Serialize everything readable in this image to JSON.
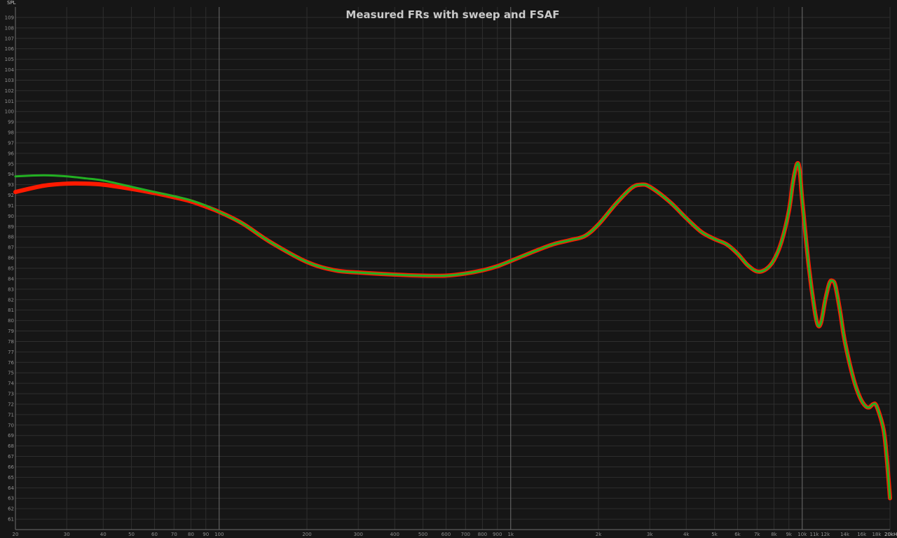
{
  "chart_data": {
    "type": "line",
    "title": "Measured FRs with sweep and FSAF",
    "ylabel": "SPL",
    "x_unit_label": "20kHz",
    "x_scale": "log",
    "xlim": [
      20,
      20000
    ],
    "ylim": [
      60,
      110
    ],
    "grid": true,
    "legend": "none",
    "background_color": "#161616",
    "grid_color": "#2e2e2e",
    "grid_major_color": "#6e6e6e",
    "series": [
      {
        "color": "#ff1a00",
        "points": [
          [
            20,
            92.3
          ],
          [
            25,
            92.9
          ],
          [
            30,
            93.1
          ],
          [
            35,
            93.1
          ],
          [
            40,
            93.0
          ],
          [
            50,
            92.6
          ],
          [
            60,
            92.2
          ],
          [
            70,
            91.8
          ],
          [
            80,
            91.4
          ],
          [
            90,
            90.9
          ],
          [
            100,
            90.4
          ],
          [
            120,
            89.3
          ],
          [
            150,
            87.5
          ],
          [
            200,
            85.6
          ],
          [
            250,
            84.8
          ],
          [
            300,
            84.6
          ],
          [
            400,
            84.4
          ],
          [
            500,
            84.3
          ],
          [
            600,
            84.3
          ],
          [
            700,
            84.5
          ],
          [
            800,
            84.8
          ],
          [
            900,
            85.2
          ],
          [
            1000,
            85.7
          ],
          [
            1200,
            86.6
          ],
          [
            1400,
            87.3
          ],
          [
            1600,
            87.7
          ],
          [
            1800,
            88.1
          ],
          [
            2000,
            89.2
          ],
          [
            2300,
            91.2
          ],
          [
            2600,
            92.7
          ],
          [
            2800,
            93.0
          ],
          [
            3000,
            92.8
          ],
          [
            3500,
            91.4
          ],
          [
            4000,
            89.8
          ],
          [
            4500,
            88.5
          ],
          [
            5000,
            87.8
          ],
          [
            5500,
            87.3
          ],
          [
            6000,
            86.4
          ],
          [
            6500,
            85.3
          ],
          [
            7000,
            84.7
          ],
          [
            7500,
            84.9
          ],
          [
            8000,
            85.8
          ],
          [
            8500,
            87.6
          ],
          [
            9000,
            90.5
          ],
          [
            9300,
            93.3
          ],
          [
            9600,
            95.0
          ],
          [
            9800,
            94.4
          ],
          [
            10000,
            91.5
          ],
          [
            10500,
            85.5
          ],
          [
            11000,
            81.2
          ],
          [
            11300,
            79.6
          ],
          [
            11600,
            79.8
          ],
          [
            12000,
            82.0
          ],
          [
            12400,
            83.6
          ],
          [
            12700,
            83.8
          ],
          [
            13000,
            83.3
          ],
          [
            13500,
            80.8
          ],
          [
            14000,
            78.0
          ],
          [
            15000,
            74.4
          ],
          [
            15800,
            72.6
          ],
          [
            16500,
            71.8
          ],
          [
            17000,
            71.7
          ],
          [
            17500,
            72.0
          ],
          [
            18000,
            71.8
          ],
          [
            19000,
            69.6
          ],
          [
            19500,
            66.8
          ],
          [
            20000,
            63.0
          ]
        ]
      },
      {
        "color": "#22b022",
        "points": [
          [
            20,
            93.8
          ],
          [
            25,
            93.9
          ],
          [
            30,
            93.8
          ],
          [
            35,
            93.6
          ],
          [
            40,
            93.4
          ],
          [
            50,
            92.8
          ],
          [
            60,
            92.3
          ],
          [
            70,
            91.9
          ],
          [
            80,
            91.5
          ],
          [
            90,
            91.0
          ],
          [
            100,
            90.4
          ],
          [
            120,
            89.3
          ],
          [
            150,
            87.5
          ],
          [
            200,
            85.6
          ],
          [
            250,
            84.8
          ],
          [
            300,
            84.6
          ],
          [
            400,
            84.4
          ],
          [
            500,
            84.3
          ],
          [
            600,
            84.3
          ],
          [
            700,
            84.5
          ],
          [
            800,
            84.8
          ],
          [
            900,
            85.2
          ],
          [
            1000,
            85.7
          ],
          [
            1200,
            86.6
          ],
          [
            1400,
            87.3
          ],
          [
            1600,
            87.7
          ],
          [
            1800,
            88.1
          ],
          [
            2000,
            89.2
          ],
          [
            2300,
            91.2
          ],
          [
            2600,
            92.7
          ],
          [
            2800,
            93.0
          ],
          [
            3000,
            92.8
          ],
          [
            3500,
            91.4
          ],
          [
            4000,
            89.8
          ],
          [
            4500,
            88.5
          ],
          [
            5000,
            87.8
          ],
          [
            5500,
            87.3
          ],
          [
            6000,
            86.4
          ],
          [
            6500,
            85.3
          ],
          [
            7000,
            84.7
          ],
          [
            7500,
            84.9
          ],
          [
            8000,
            85.8
          ],
          [
            8500,
            87.6
          ],
          [
            9000,
            90.5
          ],
          [
            9300,
            93.3
          ],
          [
            9600,
            95.0
          ],
          [
            9800,
            94.4
          ],
          [
            10000,
            91.5
          ],
          [
            10500,
            85.5
          ],
          [
            11000,
            81.2
          ],
          [
            11300,
            79.6
          ],
          [
            11600,
            79.8
          ],
          [
            12000,
            82.0
          ],
          [
            12400,
            83.6
          ],
          [
            12700,
            83.8
          ],
          [
            13000,
            83.3
          ],
          [
            13500,
            80.8
          ],
          [
            14000,
            78.0
          ],
          [
            15000,
            74.4
          ],
          [
            15800,
            72.6
          ],
          [
            16500,
            71.8
          ],
          [
            17000,
            71.7
          ],
          [
            17500,
            72.0
          ],
          [
            18000,
            71.8
          ],
          [
            19000,
            69.6
          ],
          [
            19500,
            66.8
          ],
          [
            20000,
            63.0
          ]
        ]
      }
    ],
    "x_ticks": [
      {
        "v": 20,
        "label": "20"
      },
      {
        "v": 30,
        "label": "30"
      },
      {
        "v": 40,
        "label": "40"
      },
      {
        "v": 50,
        "label": "50"
      },
      {
        "v": 60,
        "label": "60"
      },
      {
        "v": 70,
        "label": "70"
      },
      {
        "v": 80,
        "label": "80"
      },
      {
        "v": 90,
        "label": "90"
      },
      {
        "v": 100,
        "label": "100"
      },
      {
        "v": 200,
        "label": "200"
      },
      {
        "v": 300,
        "label": "300"
      },
      {
        "v": 400,
        "label": "400"
      },
      {
        "v": 500,
        "label": "500"
      },
      {
        "v": 600,
        "label": "600"
      },
      {
        "v": 700,
        "label": "700"
      },
      {
        "v": 800,
        "label": "800"
      },
      {
        "v": 900,
        "label": "900"
      },
      {
        "v": 1000,
        "label": "1k"
      },
      {
        "v": 2000,
        "label": "2k"
      },
      {
        "v": 3000,
        "label": "3k"
      },
      {
        "v": 4000,
        "label": "4k"
      },
      {
        "v": 5000,
        "label": "5k"
      },
      {
        "v": 6000,
        "label": "6k"
      },
      {
        "v": 7000,
        "label": "7k"
      },
      {
        "v": 8000,
        "label": "8k"
      },
      {
        "v": 9000,
        "label": "9k"
      },
      {
        "v": 10000,
        "label": "10k"
      },
      {
        "v": 11000,
        "label": "11k"
      },
      {
        "v": 12000,
        "label": "12k"
      },
      {
        "v": 14000,
        "label": "14k"
      },
      {
        "v": 16000,
        "label": "16k"
      },
      {
        "v": 18000,
        "label": "18k"
      }
    ],
    "x_major_lines": [
      100,
      1000,
      10000
    ],
    "y_ticks": [
      61,
      62,
      63,
      64,
      65,
      66,
      67,
      68,
      69,
      70,
      71,
      72,
      73,
      74,
      75,
      76,
      77,
      78,
      79,
      80,
      81,
      82,
      83,
      84,
      85,
      86,
      87,
      88,
      89,
      90,
      91,
      92,
      93,
      94,
      95,
      96,
      97,
      98,
      99,
      100,
      101,
      102,
      103,
      104,
      105,
      106,
      107,
      108,
      109
    ]
  }
}
